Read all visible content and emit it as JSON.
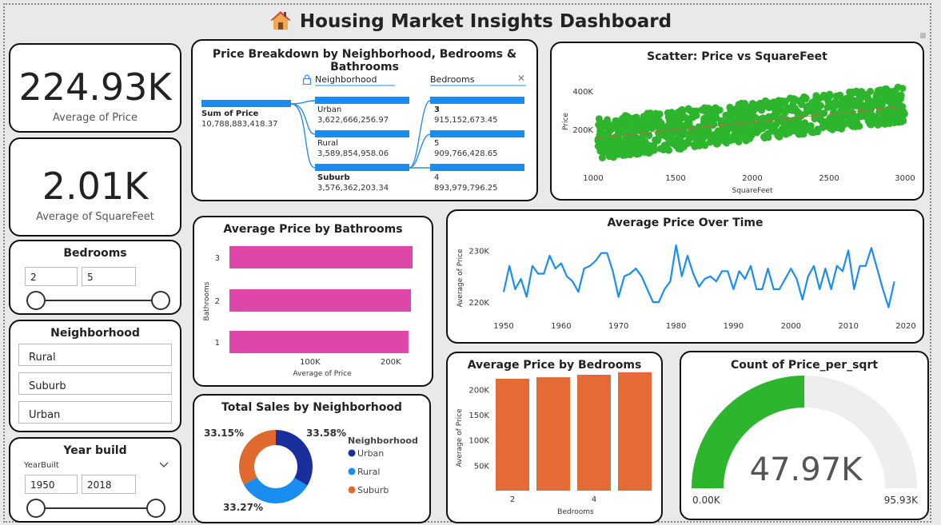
{
  "title": "Housing Market Insights Dashboard",
  "kpi_price": {
    "value": "224.93K",
    "label": "Average of Price"
  },
  "kpi_sqft": {
    "value": "2.01K",
    "label": "Average of SquareFeet"
  },
  "bedrooms_slicer": {
    "title": "Bedrooms",
    "min": "2",
    "max": "5"
  },
  "neighborhood_slicer": {
    "title": "Neighborhood",
    "items": [
      "Rural",
      "Suburb",
      "Urban"
    ]
  },
  "year_slicer": {
    "title": "Year build",
    "field": "YearBuilt",
    "min": "1950",
    "max": "2018"
  },
  "decomp": {
    "title": "Price Breakdown by Neighborhood, Bedrooms & Bathrooms",
    "root_label": "Sum of Price",
    "root_value": "10,788,883,418.37",
    "level1_header": "Neighborhood",
    "level2_header": "Bedrooms",
    "level1": [
      {
        "label": "Urban",
        "value": "3,622,666,256.97"
      },
      {
        "label": "Rural",
        "value": "3,589,854,958.06"
      },
      {
        "label": "Suburb",
        "value": "3,576,362,203.34"
      }
    ],
    "level2": [
      {
        "label": "3",
        "value": "915,152,673.45"
      },
      {
        "label": "5",
        "value": "909,766,428.65"
      },
      {
        "label": "4",
        "value": "893,979,796.25"
      }
    ],
    "close": "✕"
  },
  "scatter": {
    "title": "Scatter: Price vs SquareFeet",
    "xlabel": "SquareFeet",
    "ylabel": "Price",
    "xticks": [
      "1000",
      "1500",
      "2000",
      "2500",
      "3000"
    ],
    "yticks": [
      "400K",
      "200K"
    ],
    "color": "#2db52d",
    "trend_color": "#e05050"
  },
  "bathrooms_chart": {
    "title": "Average Price by Bathrooms",
    "ylabel": "Bathrooms",
    "xlabel": "Average of Price"
  },
  "time_chart": {
    "title": "Average Price Over Time",
    "ylabel": "Average of Price"
  },
  "donut": {
    "title": "Total Sales by Neighborhood",
    "legend_title": "Neighborhood",
    "labels": [
      "33.58%",
      "33.27%",
      "33.15%"
    ]
  },
  "bedrooms_chart": {
    "title": "Average Price by Bedrooms",
    "ylabel": "Average of Price",
    "xlabel": "Bedrooms"
  },
  "gauge": {
    "title": "Count of Price_per_sqrt",
    "value": "47.97K",
    "min": "0.00K",
    "max": "95.93K",
    "fraction": 0.5,
    "color": "#2db52d"
  },
  "chart_data": [
    {
      "type": "scatter",
      "title": "Scatter: Price vs SquareFeet",
      "xlabel": "SquareFeet",
      "ylabel": "Price",
      "xlim": [
        1000,
        3000
      ],
      "ylim": [
        0,
        500000
      ],
      "trend": [
        [
          1000,
          150000
        ],
        [
          3000,
          325000
        ]
      ],
      "band": {
        "x": [
          1000,
          3000
        ],
        "low_start": 30000,
        "low_end": 240000,
        "high_start": 260000,
        "high_end": 440000
      }
    },
    {
      "type": "bar",
      "title": "Average Price by Bathrooms",
      "categories": [
        "3",
        "2",
        "1"
      ],
      "values": [
        227000,
        225000,
        222000
      ],
      "xlabel": "Average of Price",
      "ylabel": "Bathrooms",
      "xticks": [
        "100K",
        "200K"
      ],
      "xlim": [
        0,
        230000
      ],
      "color": "#e046aa"
    },
    {
      "type": "line",
      "title": "Average Price Over Time",
      "ylabel": "Average of Price",
      "xticks": [
        "1950",
        "1960",
        "1970",
        "1980",
        "1990",
        "2000",
        "2010",
        "2020"
      ],
      "yticks": [
        "230K",
        "220K"
      ],
      "xlim": [
        1950,
        2020
      ],
      "ylim": [
        216000,
        233000
      ],
      "color": "#1a8ef0",
      "x": [
        1950,
        1951,
        1952,
        1953,
        1954,
        1955,
        1956,
        1957,
        1958,
        1959,
        1960,
        1961,
        1962,
        1963,
        1964,
        1965,
        1966,
        1967,
        1968,
        1969,
        1970,
        1971,
        1972,
        1973,
        1974,
        1975,
        1976,
        1977,
        1978,
        1979,
        1980,
        1981,
        1982,
        1983,
        1984,
        1985,
        1986,
        1987,
        1988,
        1989,
        1990,
        1991,
        1992,
        1993,
        1994,
        1995,
        1996,
        1997,
        1998,
        1999,
        2000,
        2001,
        2002,
        2003,
        2004,
        2005,
        2006,
        2007,
        2008,
        2009,
        2010,
        2011,
        2012,
        2013,
        2014,
        2015,
        2016,
        2017,
        2018
      ],
      "y": [
        222000,
        227000,
        222500,
        224500,
        221000,
        227000,
        225500,
        225500,
        229000,
        226500,
        227500,
        225000,
        224000,
        222000,
        226500,
        227000,
        228000,
        229500,
        229500,
        226000,
        221000,
        225000,
        225500,
        226500,
        225000,
        222500,
        220000,
        220000,
        222500,
        224000,
        231000,
        225000,
        229000,
        225500,
        223000,
        224500,
        225000,
        224000,
        226000,
        226000,
        222500,
        226000,
        224500,
        227000,
        222500,
        222500,
        226500,
        222500,
        222500,
        224500,
        226500,
        224500,
        220500,
        225000,
        227000,
        222500,
        226500,
        222500,
        227000,
        226000,
        230000,
        222500,
        227000,
        227000,
        230500,
        226500,
        222500,
        219000,
        224000
      ]
    },
    {
      "type": "pie",
      "title": "Total Sales by Neighborhood",
      "categories": [
        "Urban",
        "Rural",
        "Suburb"
      ],
      "values": [
        33.58,
        33.27,
        33.15
      ],
      "colors": [
        "#1a2f9c",
        "#1a8ef0",
        "#e06a2e"
      ]
    },
    {
      "type": "bar",
      "title": "Average Price by Bedrooms",
      "categories": [
        "2",
        "3",
        "4",
        "5"
      ],
      "values": [
        221000,
        224000,
        229000,
        234000
      ],
      "xlabel": "Bedrooms",
      "ylabel": "Average of Price",
      "xticks": [
        "2",
        "4"
      ],
      "yticks": [
        "200K",
        "150K",
        "100K",
        "50K"
      ],
      "ylim": [
        0,
        240000
      ],
      "color": "#e46b35"
    }
  ]
}
